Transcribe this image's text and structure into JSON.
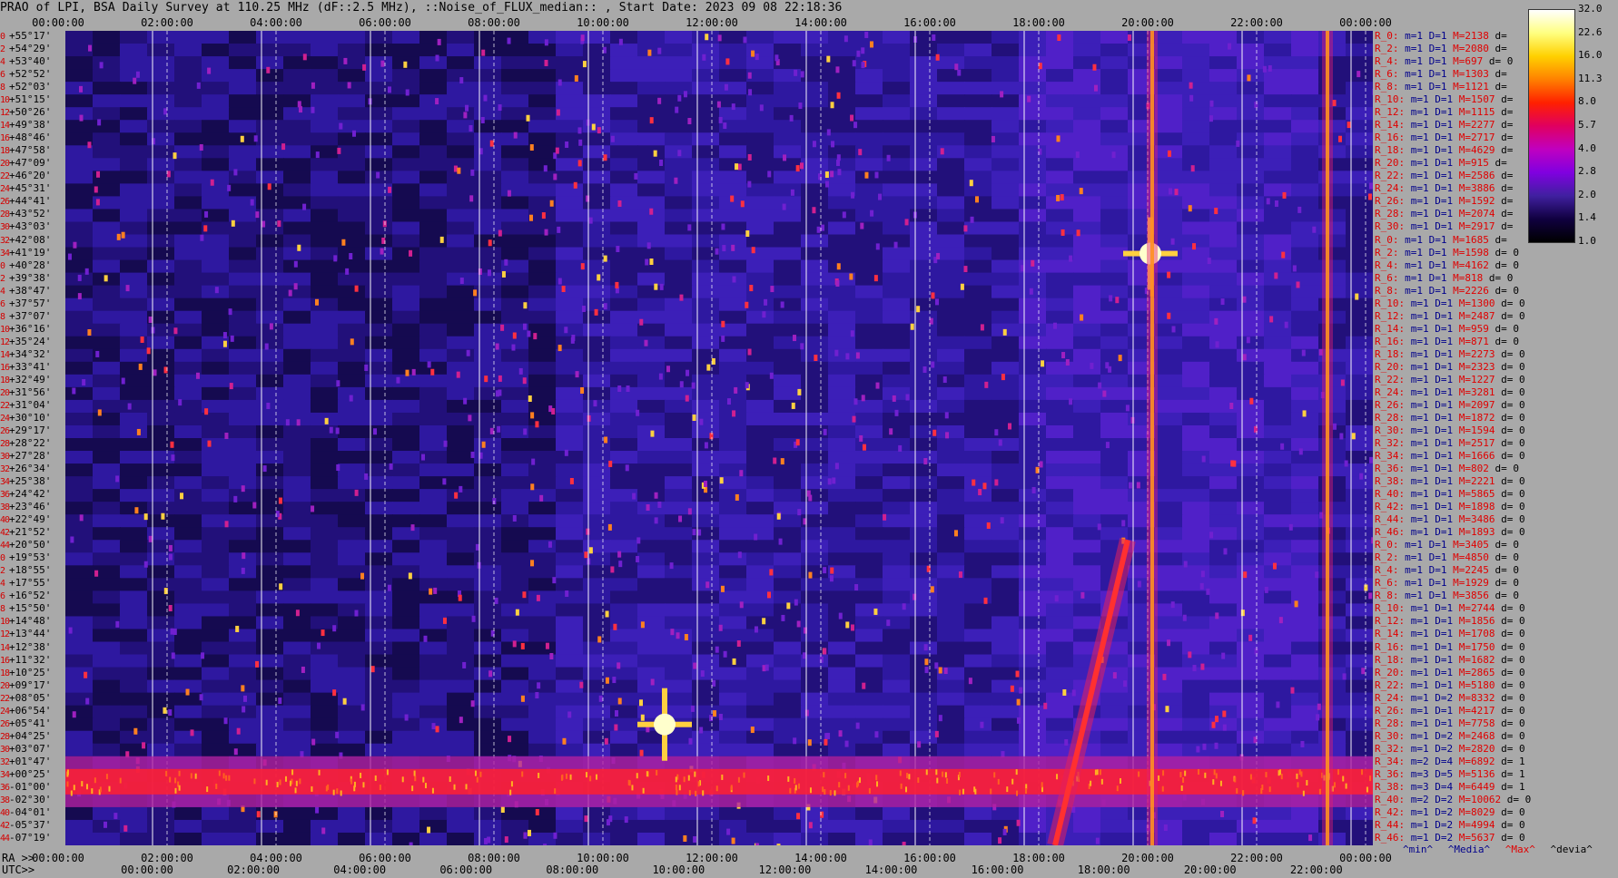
{
  "title": "PRAO of LPI, BSA Daily Survey at 110.25 MHz (dF::2.5 MHz), ::Noise_of_FLUX_median:: , Start Date: 2023 09 08 22:18:36",
  "axes": {
    "ra_prefix": "RA >>",
    "utc_prefix": "UTC>>",
    "top_ticks": [
      "00:00:00",
      "02:00:00",
      "04:00:00",
      "06:00:00",
      "08:00:00",
      "10:00:00",
      "12:00:00",
      "14:00:00",
      "16:00:00",
      "18:00:00",
      "20:00:00",
      "22:00:00",
      "00:00:00"
    ],
    "bottom_ticks": [
      "00:00:00",
      "02:00:00",
      "04:00:00",
      "06:00:00",
      "08:00:00",
      "10:00:00",
      "12:00:00",
      "14:00:00",
      "16:00:00",
      "18:00:00",
      "20:00:00",
      "22:00:00",
      "00:00:00"
    ],
    "utc_ticks": [
      "00:00:00",
      "02:00:00",
      "04:00:00",
      "06:00:00",
      "08:00:00",
      "10:00:00",
      "12:00:00",
      "14:00:00",
      "16:00:00",
      "18:00:00",
      "20:00:00",
      "22:00:00"
    ]
  },
  "declinations": [
    [
      "0",
      "+55°17'"
    ],
    [
      "2",
      "+54°29'"
    ],
    [
      "4",
      "+53°40'"
    ],
    [
      "6",
      "+52°52'"
    ],
    [
      "8",
      "+52°03'"
    ],
    [
      "10",
      "+51°15'"
    ],
    [
      "12",
      "+50°26'"
    ],
    [
      "14",
      "+49°38'"
    ],
    [
      "16",
      "+48°46'"
    ],
    [
      "18",
      "+47°58'"
    ],
    [
      "20",
      "+47°09'"
    ],
    [
      "22",
      "+46°20'"
    ],
    [
      "24",
      "+45°31'"
    ],
    [
      "26",
      "+44°41'"
    ],
    [
      "28",
      "+43°52'"
    ],
    [
      "30",
      "+43°03'"
    ],
    [
      "32",
      "+42°08'"
    ],
    [
      "34",
      "+41°19'"
    ],
    [
      "0",
      "+40°28'"
    ],
    [
      "2",
      "+39°38'"
    ],
    [
      "4",
      "+38°47'"
    ],
    [
      "6",
      "+37°57'"
    ],
    [
      "8",
      "+37°07'"
    ],
    [
      "10",
      "+36°16'"
    ],
    [
      "12",
      "+35°24'"
    ],
    [
      "14",
      "+34°32'"
    ],
    [
      "16",
      "+33°41'"
    ],
    [
      "18",
      "+32°49'"
    ],
    [
      "20",
      "+31°56'"
    ],
    [
      "22",
      "+31°04'"
    ],
    [
      "24",
      "+30°10'"
    ],
    [
      "26",
      "+29°17'"
    ],
    [
      "28",
      "+28°22'"
    ],
    [
      "30",
      "+27°28'"
    ],
    [
      "32",
      "+26°34'"
    ],
    [
      "34",
      "+25°38'"
    ],
    [
      "36",
      "+24°42'"
    ],
    [
      "38",
      "+23°46'"
    ],
    [
      "40",
      "+22°49'"
    ],
    [
      "42",
      "+21°52'"
    ],
    [
      "44",
      "+20°50'"
    ],
    [
      "0",
      "+19°53'"
    ],
    [
      "2",
      "+18°55'"
    ],
    [
      "4",
      "+17°55'"
    ],
    [
      "6",
      "+16°52'"
    ],
    [
      "8",
      "+15°50'"
    ],
    [
      "10",
      "+14°48'"
    ],
    [
      "12",
      "+13°44'"
    ],
    [
      "14",
      "+12°38'"
    ],
    [
      "16",
      "+11°32'"
    ],
    [
      "18",
      "+10°25'"
    ],
    [
      "20",
      "+09°17'"
    ],
    [
      "22",
      "+08°05'"
    ],
    [
      "24",
      "+06°54'"
    ],
    [
      "26",
      "+05°41'"
    ],
    [
      "28",
      "+04°25'"
    ],
    [
      "30",
      "+03°07'"
    ],
    [
      "32",
      "+01°47'"
    ],
    [
      "34",
      "+00°25'"
    ],
    [
      "36",
      "-01°00'"
    ],
    [
      "38",
      "-02°30'"
    ],
    [
      "40",
      "-04°01'"
    ],
    [
      "42",
      "-05°37'"
    ],
    [
      "44",
      "-07°19'"
    ]
  ],
  "stats": [
    [
      "R_0:",
      "m=1",
      "D=1",
      "M=2138",
      "d="
    ],
    [
      "R_2:",
      "m=1",
      "D=1",
      "M=2080",
      "d="
    ],
    [
      "R_4:",
      "m=1",
      "D=1",
      "M=697",
      "d= 0"
    ],
    [
      "R_6:",
      "m=1",
      "D=1",
      "M=1303",
      "d="
    ],
    [
      "R_8:",
      "m=1",
      "D=1",
      "M=1121",
      "d="
    ],
    [
      "R_10:",
      "m=1",
      "D=1",
      "M=1507",
      "d="
    ],
    [
      "R_12:",
      "m=1",
      "D=1",
      "M=1115",
      "d="
    ],
    [
      "R_14:",
      "m=1",
      "D=1",
      "M=2277",
      "d="
    ],
    [
      "R_16:",
      "m=1",
      "D=1",
      "M=2717",
      "d="
    ],
    [
      "R_18:",
      "m=1",
      "D=1",
      "M=4629",
      "d="
    ],
    [
      "R_20:",
      "m=1",
      "D=1",
      "M=915",
      "d="
    ],
    [
      "R_22:",
      "m=1",
      "D=1",
      "M=2586",
      "d="
    ],
    [
      "R_24:",
      "m=1",
      "D=1",
      "M=3886",
      "d="
    ],
    [
      "R_26:",
      "m=1",
      "D=1",
      "M=1592",
      "d="
    ],
    [
      "R_28:",
      "m=1",
      "D=1",
      "M=2074",
      "d="
    ],
    [
      "R_30:",
      "m=1",
      "D=1",
      "M=2917",
      "d="
    ],
    [
      "R_0:",
      "m=1",
      "D=1",
      "M=1685",
      "d="
    ],
    [
      "R_2:",
      "m=1",
      "D=1",
      "M=1598",
      "d= 0"
    ],
    [
      "R_4:",
      "m=1",
      "D=1",
      "M=4162",
      "d= 0"
    ],
    [
      "R_6:",
      "m=1",
      "D=1",
      "M=818",
      "d= 0"
    ],
    [
      "R_8:",
      "m=1",
      "D=1",
      "M=2226",
      "d= 0"
    ],
    [
      "R_10:",
      "m=1",
      "D=1",
      "M=1300",
      "d= 0"
    ],
    [
      "R_12:",
      "m=1",
      "D=1",
      "M=2487",
      "d= 0"
    ],
    [
      "R_14:",
      "m=1",
      "D=1",
      "M=959",
      "d= 0"
    ],
    [
      "R_16:",
      "m=1",
      "D=1",
      "M=871",
      "d= 0"
    ],
    [
      "R_18:",
      "m=1",
      "D=1",
      "M=2273",
      "d= 0"
    ],
    [
      "R_20:",
      "m=1",
      "D=1",
      "M=2323",
      "d= 0"
    ],
    [
      "R_22:",
      "m=1",
      "D=1",
      "M=1227",
      "d= 0"
    ],
    [
      "R_24:",
      "m=1",
      "D=1",
      "M=3281",
      "d= 0"
    ],
    [
      "R_26:",
      "m=1",
      "D=1",
      "M=2097",
      "d= 0"
    ],
    [
      "R_28:",
      "m=1",
      "D=1",
      "M=1872",
      "d= 0"
    ],
    [
      "R_30:",
      "m=1",
      "D=1",
      "M=1594",
      "d= 0"
    ],
    [
      "R_32:",
      "m=1",
      "D=1",
      "M=2517",
      "d= 0"
    ],
    [
      "R_34:",
      "m=1",
      "D=1",
      "M=1666",
      "d= 0"
    ],
    [
      "R_36:",
      "m=1",
      "D=1",
      "M=802",
      "d= 0"
    ],
    [
      "R_38:",
      "m=1",
      "D=1",
      "M=2221",
      "d= 0"
    ],
    [
      "R_40:",
      "m=1",
      "D=1",
      "M=5865",
      "d= 0"
    ],
    [
      "R_42:",
      "m=1",
      "D=1",
      "M=1898",
      "d= 0"
    ],
    [
      "R_44:",
      "m=1",
      "D=1",
      "M=3486",
      "d= 0"
    ],
    [
      "R_46:",
      "m=1",
      "D=1",
      "M=1893",
      "d= 0"
    ],
    [
      "R_0:",
      "m=1",
      "D=1",
      "M=3405",
      "d= 0"
    ],
    [
      "R_2:",
      "m=1",
      "D=1",
      "M=4850",
      "d= 0"
    ],
    [
      "R_4:",
      "m=1",
      "D=1",
      "M=2245",
      "d= 0"
    ],
    [
      "R_6:",
      "m=1",
      "D=1",
      "M=1929",
      "d= 0"
    ],
    [
      "R_8:",
      "m=1",
      "D=1",
      "M=3856",
      "d= 0"
    ],
    [
      "R_10:",
      "m=1",
      "D=1",
      "M=2744",
      "d= 0"
    ],
    [
      "R_12:",
      "m=1",
      "D=1",
      "M=1856",
      "d= 0"
    ],
    [
      "R_14:",
      "m=1",
      "D=1",
      "M=1708",
      "d= 0"
    ],
    [
      "R_16:",
      "m=1",
      "D=1",
      "M=1750",
      "d= 0"
    ],
    [
      "R_18:",
      "m=1",
      "D=1",
      "M=1682",
      "d= 0"
    ],
    [
      "R_20:",
      "m=1",
      "D=1",
      "M=2865",
      "d= 0"
    ],
    [
      "R_22:",
      "m=1",
      "D=1",
      "M=5180",
      "d= 0"
    ],
    [
      "R_24:",
      "m=1",
      "D=2",
      "M=8332",
      "d= 0"
    ],
    [
      "R_26:",
      "m=1",
      "D=1",
      "M=4217",
      "d= 0"
    ],
    [
      "R_28:",
      "m=1",
      "D=1",
      "M=7758",
      "d= 0"
    ],
    [
      "R_30:",
      "m=1",
      "D=2",
      "M=2468",
      "d= 0"
    ],
    [
      "R_32:",
      "m=1",
      "D=2",
      "M=2820",
      "d= 0"
    ],
    [
      "R_34:",
      "m=2",
      "D=4",
      "M=6892",
      "d= 1"
    ],
    [
      "R_36:",
      "m=3",
      "D=5",
      "M=5136",
      "d= 1"
    ],
    [
      "R_38:",
      "m=3",
      "D=4",
      "M=6449",
      "d= 1"
    ],
    [
      "R_40:",
      "m=2",
      "D=2",
      "M=10062",
      "d= 0"
    ],
    [
      "R_42:",
      "m=1",
      "D=2",
      "M=8029",
      "d= 0"
    ],
    [
      "R_44:",
      "m=1",
      "D=2",
      "M=4994",
      "d= 0"
    ],
    [
      "R_46:",
      "m=1",
      "D=2",
      "M=5637",
      "d= 0"
    ]
  ],
  "legend_footer": [
    "^min^",
    "^Media^",
    "^Max^",
    "^devia^"
  ],
  "colorbar": {
    "labels": [
      "32.0",
      "22.6",
      "16.0",
      "11.3",
      "8.0",
      "5.7",
      "4.0",
      "2.8",
      "2.0",
      "1.4",
      "1.0"
    ],
    "scale": "log",
    "range": [
      1.0,
      32.0
    ],
    "colors": [
      "#ffffff",
      "#ffff80",
      "#ffd000",
      "#ff8000",
      "#ff2000",
      "#e00060",
      "#c000c0",
      "#8000e0",
      "#4020a0",
      "#100040",
      "#000000"
    ]
  },
  "chart_data": {
    "type": "heatmap",
    "title": "PRAO of LPI, BSA Daily Survey at 110.25 MHz (dF::2.5 MHz), ::Noise_of_FLUX_median:: , Start Date: 2023 09 08 22:18:36",
    "x_axis": "RA 00:00:00 to 24:00:00",
    "y_axis": "Declination +55°17' to -07°19'",
    "value_range": [
      1.0,
      32.0
    ],
    "scale": "log",
    "features": [
      {
        "kind": "strong horizontal band",
        "dec": "+00°25' to -01°00'",
        "value_approx": 8.0
      },
      {
        "kind": "bright point source",
        "ra": "11:00",
        "dec": "+05°41'",
        "value_approx": 32.0
      },
      {
        "kind": "bright point source",
        "ra": "19:55",
        "dec": "+41°19'",
        "value_approx": 32.0
      },
      {
        "kind": "diagonal bright track",
        "ra_start": "18:10",
        "dec_start": "-07°19'",
        "ra_end": "19:30",
        "dec_end": "+20°50'",
        "value_approx": 8.0
      },
      {
        "kind": "vertical bright column",
        "ra": "19:57",
        "value_approx": 11.3
      },
      {
        "kind": "vertical bright column",
        "ra": "23:10",
        "value_approx": 8.0
      }
    ]
  }
}
